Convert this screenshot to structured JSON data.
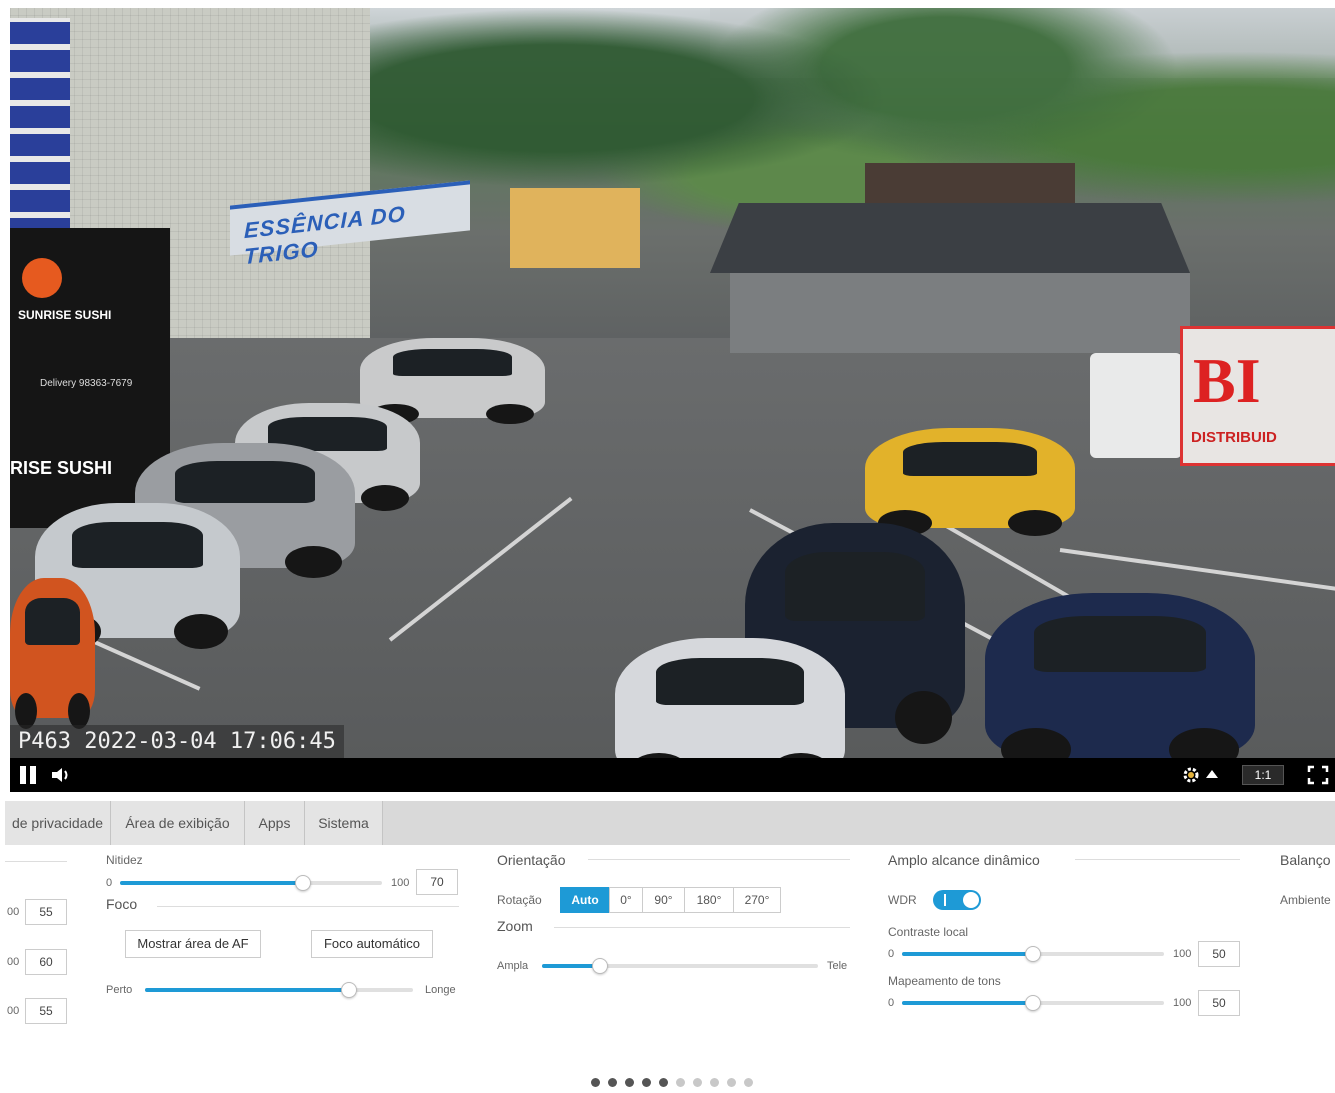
{
  "video": {
    "timestamp": "P463  2022-03-04  17:06:45",
    "shop_sign": "ESSÊNCIA DO TRIGO",
    "banner_top": "SUNRISE SUSHI",
    "banner_mid": "Delivery 98363-7679",
    "banner_bottom": "RISE SUSHI",
    "truck_big": "BI",
    "truck_small": "DISTRIBUID"
  },
  "player": {
    "ratio_label": "1:1",
    "icons": [
      "pause-icon",
      "volume-icon",
      "settings-icon",
      "caret-up-icon",
      "fullscreen-icon"
    ]
  },
  "tabs": [
    {
      "label": "de privacidade"
    },
    {
      "label": "Área de exibição"
    },
    {
      "label": "Apps"
    },
    {
      "label": "Sistema"
    }
  ],
  "left_partial": {
    "values": [
      "55",
      "60",
      "55"
    ],
    "max_label": "00"
  },
  "sharpness": {
    "label": "Nitidez",
    "min": "0",
    "max": "100",
    "value": "70",
    "fraction": 0.7
  },
  "focus": {
    "title": "Foco",
    "show_af_area": "Mostrar área de AF",
    "auto_focus": "Foco automático",
    "near": "Perto",
    "far": "Longe",
    "fraction": 0.76
  },
  "orientation": {
    "title": "Orientação",
    "rotation_label": "Rotação",
    "options": [
      "Auto",
      "0°",
      "90°",
      "180°",
      "270°"
    ],
    "selected": "Auto"
  },
  "zoom": {
    "title": "Zoom",
    "wide": "Ampla",
    "tele": "Tele",
    "fraction": 0.21
  },
  "wdr": {
    "title": "Amplo alcance dinâmico",
    "wdr_label": "WDR",
    "wdr_on": true,
    "local_contrast": {
      "label": "Contraste local",
      "min": "0",
      "max": "100",
      "value": "50",
      "fraction": 0.5
    },
    "tone_mapping": {
      "label": "Mapeamento de tons",
      "min": "0",
      "max": "100",
      "value": "50",
      "fraction": 0.5
    }
  },
  "balance": {
    "title": "Balanço",
    "ambient": "Ambiente"
  },
  "pagination": {
    "total": 10,
    "active": 5,
    "active_color": "#555555",
    "inactive_color": "#c8c8c8"
  },
  "colors": {
    "accent": "#1e9ad6"
  }
}
